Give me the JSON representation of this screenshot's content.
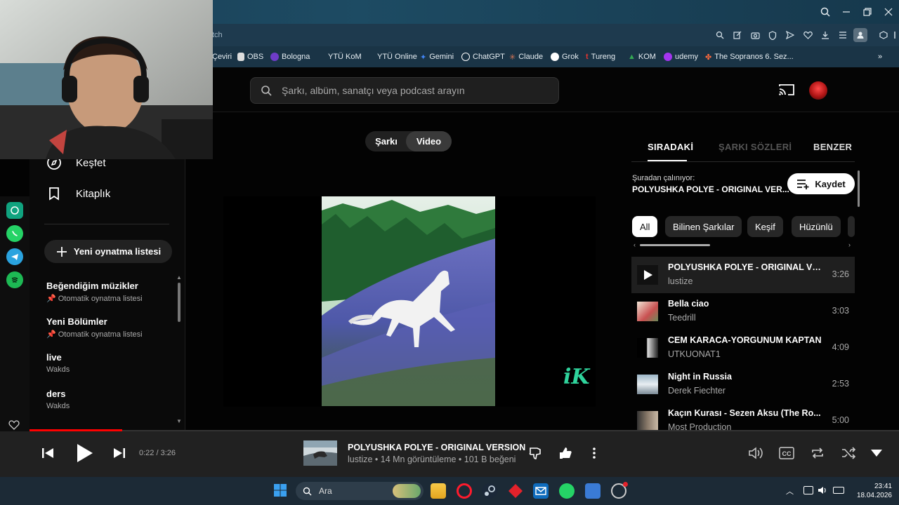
{
  "browser": {
    "url_fragment": "tch",
    "bookmarks": [
      {
        "label": "Çeviri",
        "color": "#4a8ef0"
      },
      {
        "label": "OBS",
        "color": "#cccccc"
      },
      {
        "label": "Bologna",
        "color": "#6e3cc8"
      },
      {
        "label": "YTÜ KoM",
        "color": ""
      },
      {
        "label": "YTÜ Online",
        "color": ""
      },
      {
        "label": "Gemini",
        "color": "#4285f4"
      },
      {
        "label": "ChatGPT",
        "color": "#ffffff"
      },
      {
        "label": "Claude",
        "color": "#d97757"
      },
      {
        "label": "Grok",
        "color": "#ffffff"
      },
      {
        "label": "Tureng",
        "color": "#e3342f"
      },
      {
        "label": "KOM",
        "color": "#34a853"
      },
      {
        "label": "udemy",
        "color": "#a435f0"
      },
      {
        "label": "The Sopranos 6. Sez...",
        "color": "#ff6a3d"
      }
    ]
  },
  "search": {
    "placeholder": "Şarkı, albüm, sanatçı veya podcast arayın"
  },
  "sidebar": {
    "nav": [
      {
        "label": "Keşfet",
        "icon": "compass-icon"
      },
      {
        "label": "Kitaplık",
        "icon": "bookmark-icon"
      }
    ],
    "new_playlist": "Yeni oynatma listesi",
    "playlists": [
      {
        "title": "Beğendiğim müzikler",
        "subtitle": "📌 Otomatik oynatma listesi"
      },
      {
        "title": "Yeni Bölümler",
        "subtitle": "📌 Otomatik oynatma listesi"
      },
      {
        "title": "live",
        "subtitle": "Wakds"
      },
      {
        "title": "ders",
        "subtitle": "Wakds"
      }
    ]
  },
  "center": {
    "toggle": {
      "song": "Şarkı",
      "video": "Video",
      "selected": "Video"
    },
    "watermark": "iK"
  },
  "right_panel": {
    "tabs": [
      "SIRADAKİ",
      "ŞARKI SÖZLERİ",
      "BENZER"
    ],
    "active_tab": "SIRADAKİ",
    "playing_from_label": "Şuradan çalınıyor:",
    "playing_from_name": "POLYUSHKA POLYE - ORIGINAL VER...",
    "save_label": "Kaydet",
    "chips": [
      "All",
      "Bilinen Şarkılar",
      "Keşif",
      "Hüzünlü"
    ],
    "active_chip": "All",
    "queue": [
      {
        "title": "POLYUSHKA POLYE - ORIGINAL VE...",
        "artist": "lustize",
        "duration": "3:26",
        "active": true
      },
      {
        "title": "Bella ciao",
        "artist": "Teedrill",
        "duration": "3:03"
      },
      {
        "title": "CEM KARACA-YORGUNUM KAPTAN",
        "artist": "UTKUONAT1",
        "duration": "4:09"
      },
      {
        "title": "Night in Russia",
        "artist": "Derek Fiechter",
        "duration": "2:53"
      },
      {
        "title": "Kaçın Kurası - Sezen Aksu (The Ro...",
        "artist": "Most Production",
        "duration": "5:00"
      }
    ]
  },
  "player": {
    "time": "0:22 / 3:26",
    "progress_fraction": 0.107,
    "title": "POLYUSHKA POLYE - ORIGINAL VERSION",
    "subtitle": "lustize • 14 Mn görüntüleme • 101 B beğeni"
  },
  "taskbar": {
    "search_label": "Ara",
    "time": "23:41",
    "date": "18.04.2026"
  },
  "colors": {
    "accent": "#ff0000",
    "background": "#030303",
    "player": "#212121"
  }
}
